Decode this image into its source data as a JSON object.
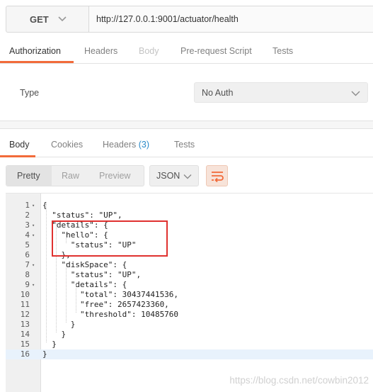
{
  "request": {
    "method": "GET",
    "url": "http://127.0.0.1:9001/actuator/health"
  },
  "request_tabs": [
    {
      "label": "Authorization",
      "state": "active"
    },
    {
      "label": "Headers",
      "state": "normal"
    },
    {
      "label": "Body",
      "state": "disabled"
    },
    {
      "label": "Pre-request Script",
      "state": "normal"
    },
    {
      "label": "Tests",
      "state": "normal"
    }
  ],
  "auth": {
    "type_label": "Type",
    "selected": "No Auth"
  },
  "response_tabs": [
    {
      "label": "Body",
      "state": "active"
    },
    {
      "label": "Cookies",
      "state": "normal"
    },
    {
      "label": "Headers",
      "count": "(3)",
      "state": "normal"
    },
    {
      "label": "Tests",
      "state": "normal"
    }
  ],
  "view": {
    "buttons": [
      "Pretty",
      "Raw",
      "Preview"
    ],
    "active": "Pretty",
    "format": "JSON"
  },
  "editor": {
    "current_line": 16,
    "lines": [
      {
        "n": "1",
        "fold": true,
        "text": "{"
      },
      {
        "n": "2",
        "fold": false,
        "text": "  \"status\": \"UP\","
      },
      {
        "n": "3",
        "fold": true,
        "text": "  \"details\": {"
      },
      {
        "n": "4",
        "fold": true,
        "text": "    \"hello\": {"
      },
      {
        "n": "5",
        "fold": false,
        "text": "      \"status\": \"UP\""
      },
      {
        "n": "6",
        "fold": false,
        "text": "    },"
      },
      {
        "n": "7",
        "fold": true,
        "text": "    \"diskSpace\": {"
      },
      {
        "n": "8",
        "fold": false,
        "text": "      \"status\": \"UP\","
      },
      {
        "n": "9",
        "fold": true,
        "text": "      \"details\": {"
      },
      {
        "n": "10",
        "fold": false,
        "text": "        \"total\": 30437441536,"
      },
      {
        "n": "11",
        "fold": false,
        "text": "        \"free\": 2657423360,"
      },
      {
        "n": "12",
        "fold": false,
        "text": "        \"threshold\": 10485760"
      },
      {
        "n": "13",
        "fold": false,
        "text": "      }"
      },
      {
        "n": "14",
        "fold": false,
        "text": "    }"
      },
      {
        "n": "15",
        "fold": false,
        "text": "  }"
      },
      {
        "n": "16",
        "fold": false,
        "text": "}"
      }
    ]
  },
  "watermark": "https://blog.csdn.net/cowbin2012",
  "colors": {
    "accent": "#f26b3a",
    "highlight_box": "#e0312f",
    "count": "#2a8ac9"
  }
}
